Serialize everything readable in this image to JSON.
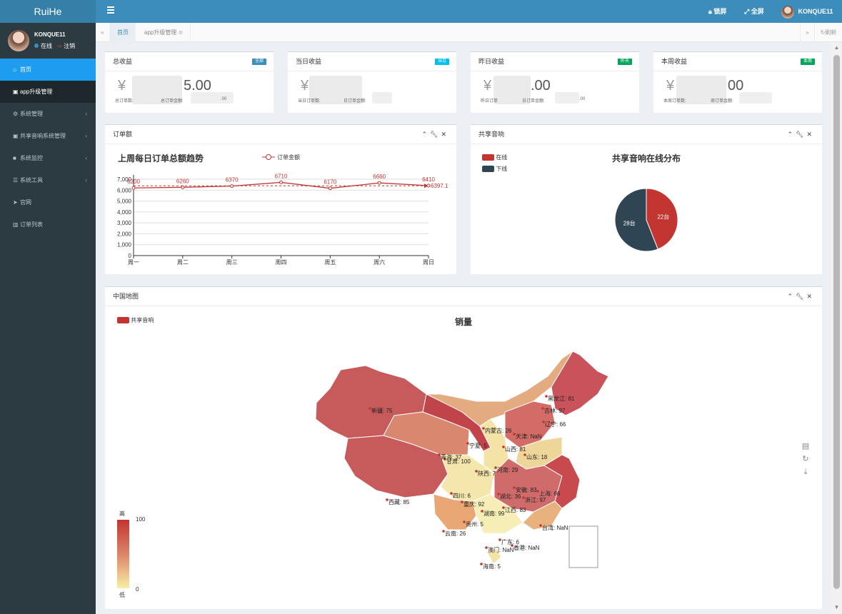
{
  "app": {
    "logo": "RuiHe"
  },
  "topnav": {
    "lock": "锁屏",
    "fullscreen": "全屏",
    "username": "KONQUE11"
  },
  "user": {
    "name": "KONQUE11",
    "online": "在线",
    "logout": "注销"
  },
  "sidebar": {
    "items": [
      {
        "label": "首页",
        "icon": "home-icon"
      },
      {
        "label": "app升级管理",
        "icon": "id-card-icon"
      },
      {
        "label": "系统管理",
        "icon": "gear-icon"
      },
      {
        "label": "共享音响系统管理",
        "icon": "id-card-icon"
      },
      {
        "label": "系统监控",
        "icon": "video-camera-icon"
      },
      {
        "label": "系统工具",
        "icon": "list-icon"
      },
      {
        "label": "官网",
        "icon": "paper-plane-icon"
      },
      {
        "label": "订单列表",
        "icon": "bar-chart-icon"
      }
    ]
  },
  "tabs": {
    "items": [
      {
        "label": "首页"
      },
      {
        "label": "app升级管理"
      }
    ],
    "refresh": "刷新"
  },
  "stats": [
    {
      "title": "总收益",
      "badge": "全部",
      "badge_color": "#3c8dbc",
      "amount_visible": "5.00",
      "currency": "¥",
      "sub1": "总订单数:",
      "sub2": "总订单金额:",
      "sub_tail": ".00"
    },
    {
      "title": "当日收益",
      "badge": "当日",
      "badge_color": "#00c0ef",
      "amount_visible": "",
      "currency": "¥",
      "sub1": "当日订单数:",
      "sub2": "日订单金额:",
      "sub_tail": ""
    },
    {
      "title": "昨日收益",
      "badge": "昨天",
      "badge_color": "#00a65a",
      "amount_visible": ".00",
      "currency": "¥",
      "sub1": "昨日订单",
      "sub2": "日订单金额:",
      "sub_tail": ".00"
    },
    {
      "title": "本周收益",
      "badge": "本周",
      "badge_color": "#00a65a",
      "amount_visible": "00",
      "currency": "¥",
      "sub1": "本周订单数:",
      "sub2": "周订单金额:",
      "sub_tail": ""
    }
  ],
  "order_box": {
    "title": "订单额"
  },
  "speaker_box": {
    "title": "共享音响"
  },
  "map_box": {
    "title": "中国地图"
  },
  "colors": {
    "accent": "#3c8dbc",
    "line_red": "#c23531",
    "navy": "#2f4554"
  },
  "chart_data": [
    {
      "type": "line",
      "title": "上周每日订单总额趋势",
      "legend": "订单金额",
      "categories": [
        "周一",
        "周二",
        "周三",
        "周四",
        "周五",
        "周六",
        "周日"
      ],
      "series": [
        {
          "name": "订单金额",
          "values": [
            6200,
            6260,
            6370,
            6710,
            6170,
            6660,
            6410
          ]
        }
      ],
      "data_labels": [
        "6200",
        "6260",
        "6370",
        "6710",
        "6170",
        "6660",
        "6410"
      ],
      "average_line": {
        "value": 6397.1,
        "label": "6397.1"
      },
      "y_ticks": [
        "0",
        "1,000",
        "2,000",
        "3,000",
        "4,000",
        "5,000",
        "6,000",
        "7,000"
      ],
      "ylim": [
        0,
        7000
      ]
    },
    {
      "type": "pie",
      "title": "共享音响在线分布",
      "legend": [
        "在线",
        "下线"
      ],
      "slices": [
        {
          "name": "在线",
          "value": 22,
          "label": "22台",
          "color": "#c23531"
        },
        {
          "name": "下线",
          "value": 28,
          "label": "28台",
          "color": "#2f4554"
        }
      ]
    },
    {
      "type": "map",
      "title": "销量",
      "legend": "共享音响",
      "visual_map": {
        "min": 0,
        "max": 100,
        "high_label": "高",
        "low_label": "低",
        "max_text": "100",
        "min_text": "0"
      },
      "regions": [
        {
          "label": "新疆: 75",
          "value": 75
        },
        {
          "label": "西藏: 85",
          "value": 85
        },
        {
          "label": "内蒙古: 26",
          "value": 26
        },
        {
          "label": "黑龙江: 81",
          "value": 81
        },
        {
          "label": "吉林: 97",
          "value": 97
        },
        {
          "label": "辽宁: 66",
          "value": 66
        },
        {
          "label": "甘肃: 100",
          "value": 100
        },
        {
          "label": "宁夏: 5",
          "value": 5
        },
        {
          "label": "青海: 37",
          "value": 37
        },
        {
          "label": "山东: 18",
          "value": 18
        },
        {
          "label": "河南: 29",
          "value": 29
        },
        {
          "label": "陕西: 7",
          "value": 7
        },
        {
          "label": "四川: 6",
          "value": 6
        },
        {
          "label": "湖北: 36",
          "value": 36
        },
        {
          "label": "安徽: 83",
          "value": 83
        },
        {
          "label": "上海: 66",
          "value": 66
        },
        {
          "label": "浙江: 97",
          "value": 97
        },
        {
          "label": "江西: 83",
          "value": 83
        },
        {
          "label": "湖南: 99",
          "value": 99
        },
        {
          "label": "重庆: 92",
          "value": 92
        },
        {
          "label": "贵州: 5",
          "value": 5
        },
        {
          "label": "云南: 26",
          "value": 26
        },
        {
          "label": "广东: 6",
          "value": 6
        },
        {
          "label": "海南: 5",
          "value": 5
        },
        {
          "label": "山西: 81",
          "value": 81
        },
        {
          "label": "天津: NaN",
          "value": null
        },
        {
          "label": "台湾: NaN",
          "value": null
        },
        {
          "label": "香港: NaN",
          "value": null
        },
        {
          "label": "澳门: NaN",
          "value": null
        }
      ]
    }
  ]
}
